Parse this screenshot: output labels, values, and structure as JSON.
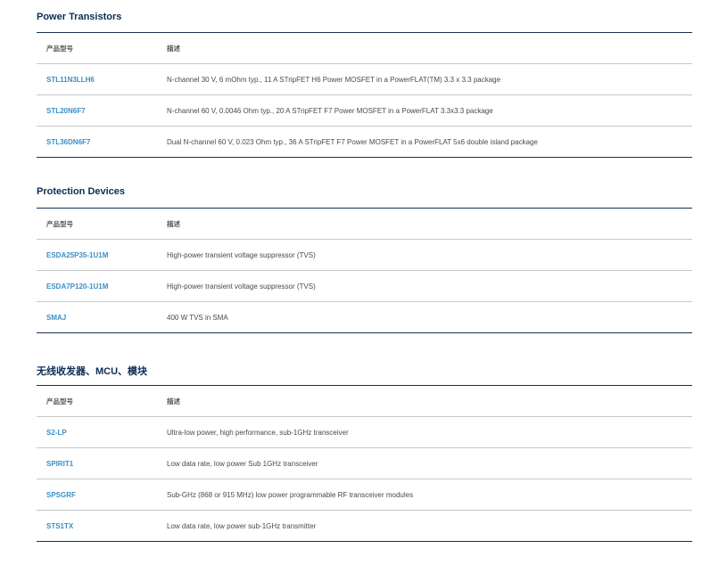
{
  "sections": [
    {
      "title": "Power Transistors",
      "header": {
        "part": "产品型号",
        "desc": "描述"
      },
      "rows": [
        {
          "part": "STL11N3LLH6",
          "desc": "N-channel 30 V, 6 mOhm typ., 11 A STripFET H6 Power MOSFET in a PowerFLAT(TM) 3.3 x 3.3 package"
        },
        {
          "part": "STL20N6F7",
          "desc": "N-channel 60 V, 0.0046 Ohm typ., 20 A STripFET F7 Power MOSFET in a PowerFLAT 3.3x3.3 package"
        },
        {
          "part": "STL36DN6F7",
          "desc": "Dual N-channel 60 V, 0.023 Ohm typ., 36 A STripFET F7 Power MOSFET in a PowerFLAT 5x6 double island package"
        }
      ]
    },
    {
      "title": "Protection Devices",
      "header": {
        "part": "产品型号",
        "desc": "描述"
      },
      "rows": [
        {
          "part": "ESDA25P35-1U1M",
          "desc": "High-power transient voltage suppressor (TVS)"
        },
        {
          "part": "ESDA7P120-1U1M",
          "desc": "High-power transient voltage suppressor (TVS)"
        },
        {
          "part": "SMAJ",
          "desc": "400 W TVS in SMA"
        }
      ]
    },
    {
      "title": "无线收发器、MCU、模块",
      "header": {
        "part": "产品型号",
        "desc": "描述"
      },
      "rows": [
        {
          "part": "S2-LP",
          "desc": "Ultra-low power, high performance, sub-1GHz transceiver"
        },
        {
          "part": "SPIRIT1",
          "desc": "Low data rate, low power Sub 1GHz transceiver"
        },
        {
          "part": "SPSGRF",
          "desc": "Sub-GHz (868 or 915 MHz) low power programmable RF transceiver modules"
        },
        {
          "part": "STS1TX",
          "desc": "Low data rate, low power sub-1GHz transmitter"
        }
      ]
    }
  ]
}
